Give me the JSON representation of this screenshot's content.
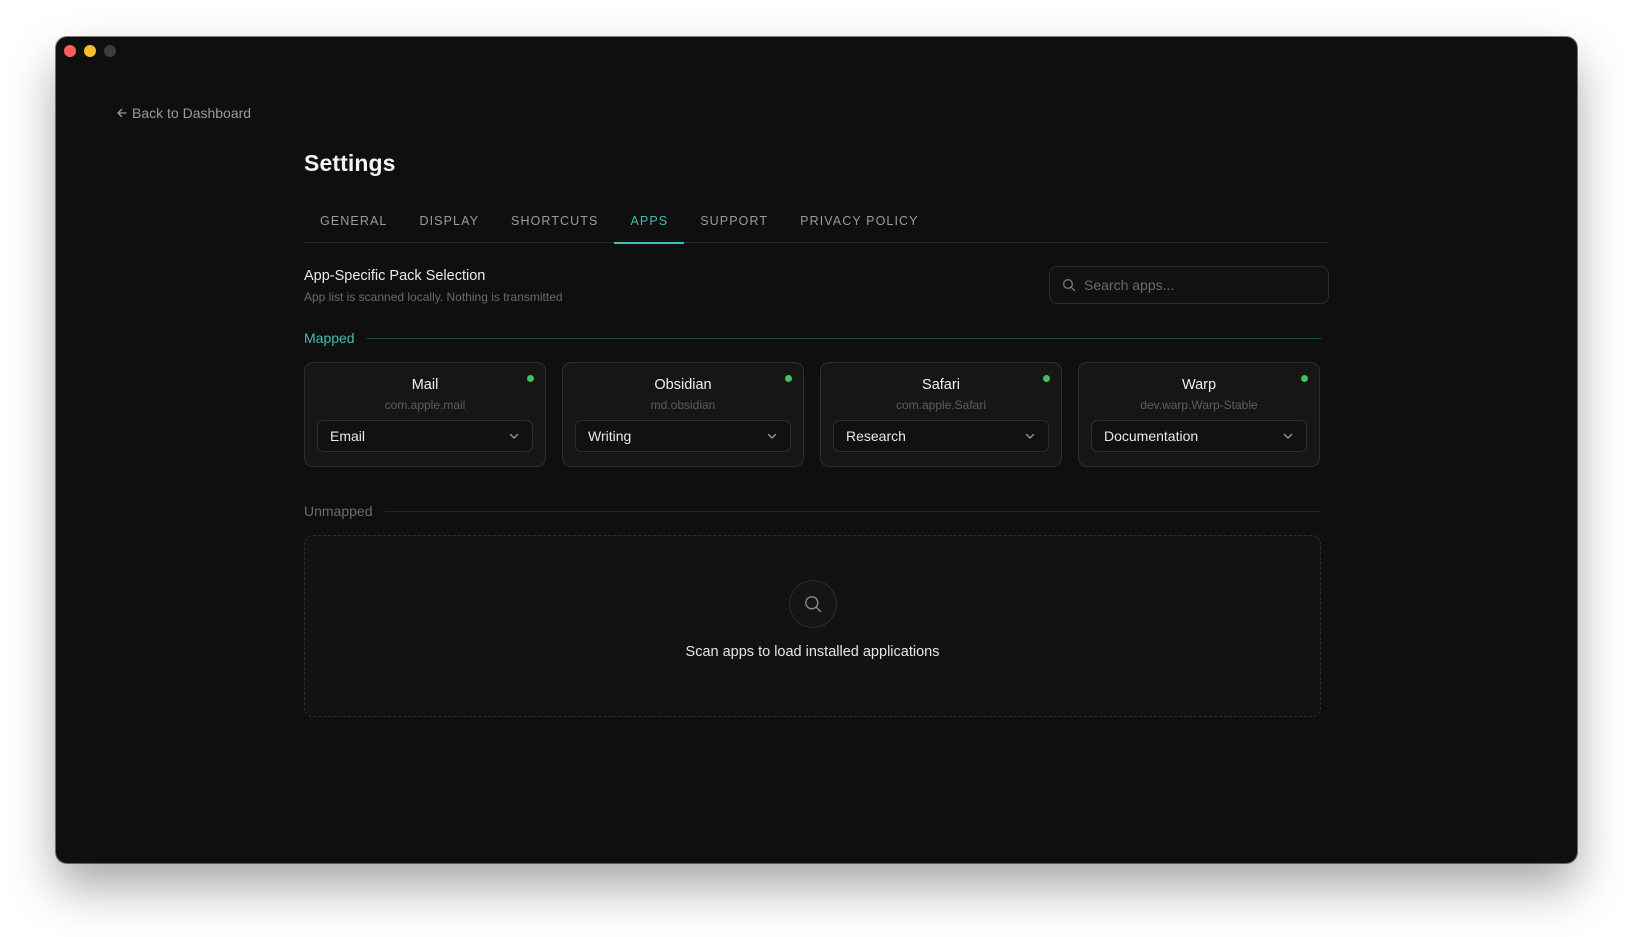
{
  "nav": {
    "back_label": "Back to Dashboard"
  },
  "page": {
    "title": "Settings"
  },
  "tabs": [
    {
      "label": "GENERAL",
      "active": false
    },
    {
      "label": "DISPLAY",
      "active": false
    },
    {
      "label": "SHORTCUTS",
      "active": false
    },
    {
      "label": "APPS",
      "active": true
    },
    {
      "label": "SUPPORT",
      "active": false
    },
    {
      "label": "PRIVACY POLICY",
      "active": false
    }
  ],
  "section": {
    "title": "App-Specific Pack Selection",
    "subtitle": "App list is scanned locally. Nothing is transmitted"
  },
  "search": {
    "placeholder": "Search apps...",
    "value": ""
  },
  "mapped": {
    "label": "Mapped",
    "apps": [
      {
        "name": "Mail",
        "bundle": "com.apple.mail",
        "pack": "Email",
        "status": "active"
      },
      {
        "name": "Obsidian",
        "bundle": "md.obsidian",
        "pack": "Writing",
        "status": "active"
      },
      {
        "name": "Safari",
        "bundle": "com.apple.Safari",
        "pack": "Research",
        "status": "active"
      },
      {
        "name": "Warp",
        "bundle": "dev.warp.Warp-Stable",
        "pack": "Documentation",
        "status": "active"
      }
    ]
  },
  "unmapped": {
    "label": "Unmapped",
    "empty_message": "Scan apps to load installed applications",
    "empty_icon": "search-icon"
  },
  "colors": {
    "accent": "#3fbfb0",
    "status_active": "#3ec25f",
    "window_bg": "#0f0f0f"
  }
}
